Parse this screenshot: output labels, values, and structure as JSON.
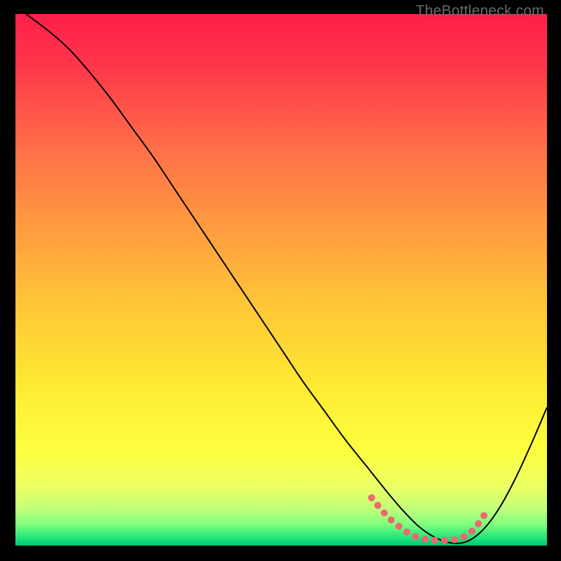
{
  "watermark": "TheBottleneck.com",
  "chart_data": {
    "type": "line",
    "title": "",
    "xlabel": "",
    "ylabel": "",
    "xlim": [
      0,
      100
    ],
    "ylim": [
      0,
      100
    ],
    "background_gradient_stops": [
      {
        "offset": 0.0,
        "color": "#ff1f4a"
      },
      {
        "offset": 0.1,
        "color": "#ff374b"
      },
      {
        "offset": 0.25,
        "color": "#ff6e48"
      },
      {
        "offset": 0.4,
        "color": "#ff9b40"
      },
      {
        "offset": 0.55,
        "color": "#ffc637"
      },
      {
        "offset": 0.7,
        "color": "#feea32"
      },
      {
        "offset": 0.82,
        "color": "#fdff3f"
      },
      {
        "offset": 0.89,
        "color": "#ebff64"
      },
      {
        "offset": 0.93,
        "color": "#c2ff79"
      },
      {
        "offset": 0.96,
        "color": "#80ff7f"
      },
      {
        "offset": 0.985,
        "color": "#23e57a"
      },
      {
        "offset": 1.0,
        "color": "#00c875"
      }
    ],
    "series": [
      {
        "name": "main-curve",
        "color": "#000000",
        "stroke_width": 2,
        "x": [
          2,
          6,
          10,
          14,
          18,
          22,
          26,
          30,
          34,
          38,
          42,
          46,
          50,
          54,
          58,
          62,
          66,
          70,
          73,
          76,
          79,
          82,
          85,
          88,
          91,
          94,
          97,
          100
        ],
        "y": [
          100,
          97,
          93.5,
          89,
          84,
          78.5,
          73,
          67,
          61,
          55,
          49,
          43,
          37,
          31,
          25.5,
          20,
          15,
          10,
          6.5,
          3.5,
          1.5,
          0.5,
          0.8,
          3,
          7,
          12.5,
          19,
          26
        ]
      },
      {
        "name": "highlight-band",
        "color": "#ec6a6f",
        "stroke_width": 10,
        "linecap": "round",
        "dash": "0.1 14",
        "x": [
          67,
          70,
          73,
          75,
          77,
          79,
          81,
          83,
          85,
          87,
          89
        ],
        "y": [
          9.0,
          5.5,
          3.0,
          1.8,
          1.2,
          1.0,
          1.0,
          1.2,
          2.0,
          4.0,
          7.0
        ]
      }
    ]
  }
}
